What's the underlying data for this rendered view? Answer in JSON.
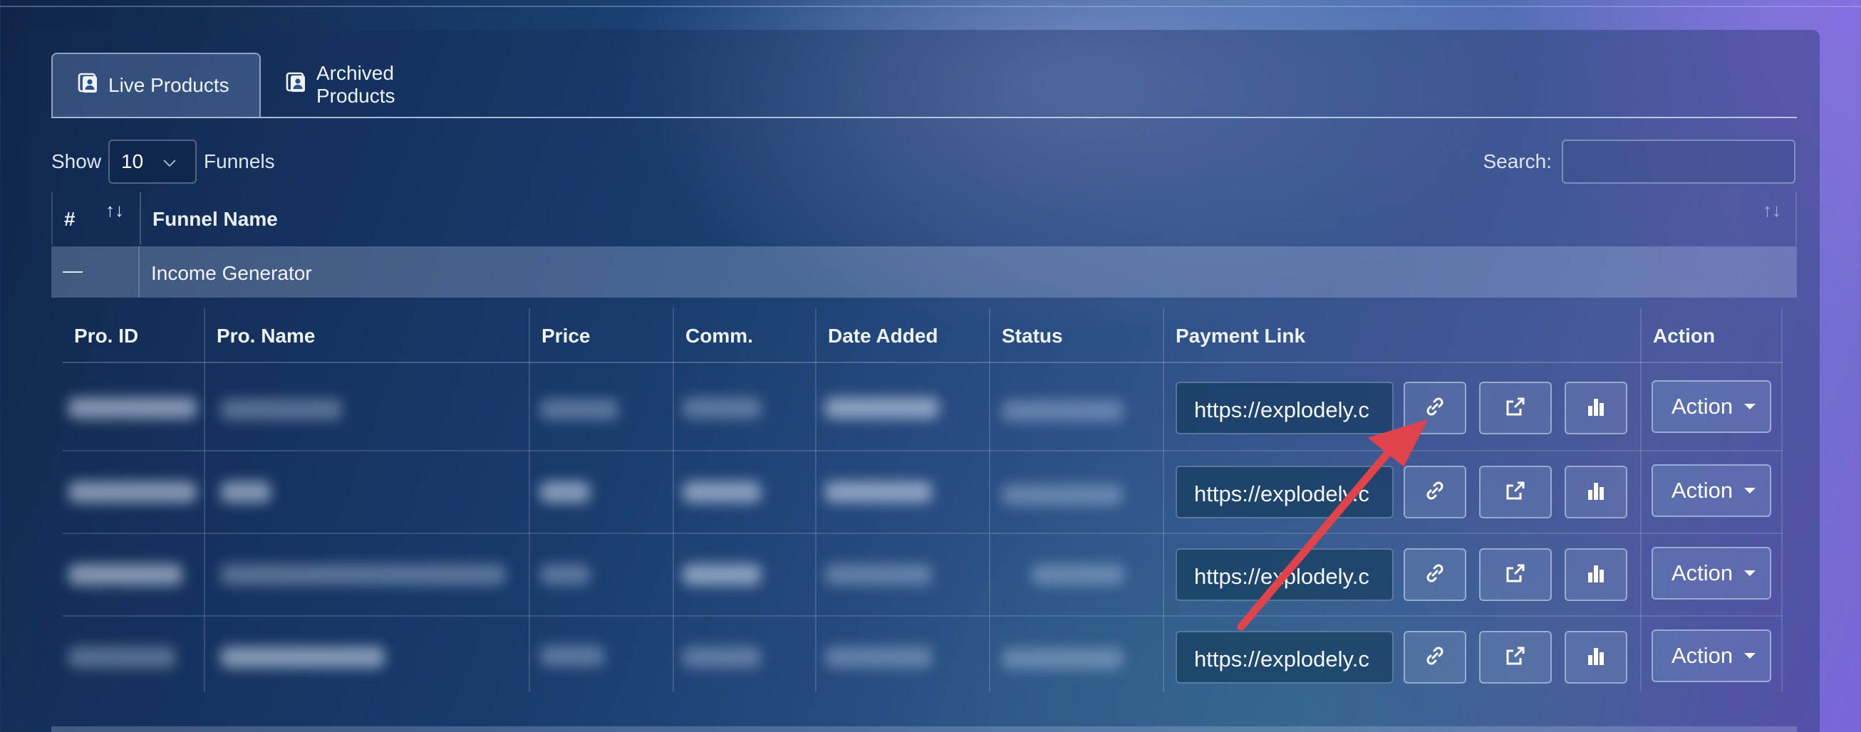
{
  "tabs": [
    {
      "label": "Live Products",
      "active": true
    },
    {
      "label": "Archived Products",
      "active": false
    }
  ],
  "controls": {
    "show_label": "Show",
    "page_size": "10",
    "funnels_label": "Funnels",
    "search_label": "Search:",
    "search_value": ""
  },
  "outer_table": {
    "col_index": "#",
    "col_name": "Funnel Name",
    "group": {
      "toggle": "—",
      "name": "Income Generator"
    }
  },
  "inner_table": {
    "headers": [
      "Pro. ID",
      "Pro. Name",
      "Price",
      "Comm.",
      "Date Added",
      "Status",
      "Payment Link",
      "Action"
    ],
    "rows": [
      {
        "payment_link": "https://explodely.c",
        "action": "Action"
      },
      {
        "payment_link": "https://explodely.c",
        "action": "Action"
      },
      {
        "payment_link": "https://explodely.c",
        "action": "Action"
      },
      {
        "payment_link": "https://explodely.c",
        "action": "Action"
      }
    ]
  },
  "icons": {
    "tab_icon": "contact-book-icon",
    "copy_link": "link-icon",
    "open_link": "external-link-icon",
    "stats": "bar-chart-icon",
    "annotation": "red-arrow"
  },
  "colors": {
    "annotation_arrow": "#e0444a"
  }
}
